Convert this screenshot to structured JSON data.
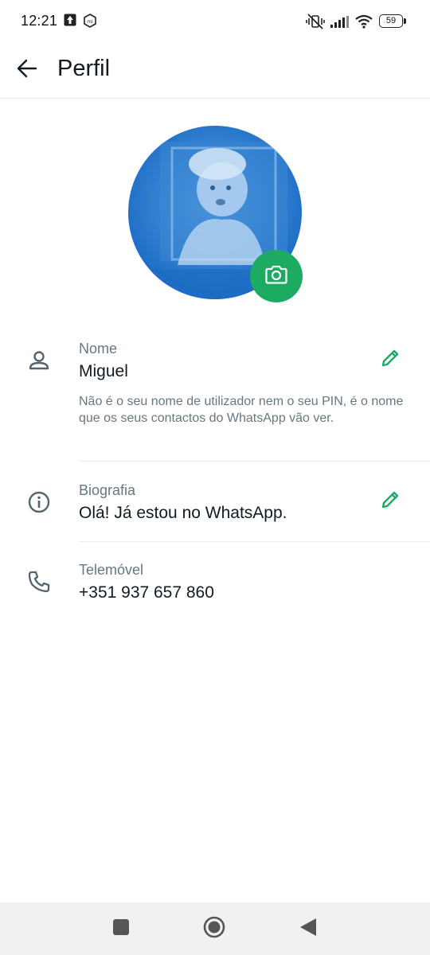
{
  "status_bar": {
    "time": "12:21",
    "battery": "59",
    "icons": [
      "upload-icon",
      "mi-icon",
      "mute-vibrate-icon",
      "signal-icon",
      "wifi-icon",
      "battery-icon"
    ]
  },
  "app_bar": {
    "title": "Perfil",
    "back_icon": "arrow-left-icon"
  },
  "profile": {
    "avatar_icon": "profile-photo",
    "camera_icon": "camera-icon"
  },
  "fields": {
    "name": {
      "label": "Nome",
      "value": "Miguel",
      "hint": "Não é o seu nome de utilizador nem o seu PIN, é o nome que os seus contactos do WhatsApp vão ver.",
      "icon": "person-icon",
      "edit_icon": "pencil-icon"
    },
    "bio": {
      "label": "Biografia",
      "value": "Olá! Já estou no WhatsApp.",
      "icon": "info-icon",
      "edit_icon": "pencil-icon"
    },
    "phone": {
      "label": "Telemóvel",
      "value": "+351 937 657 860",
      "icon": "phone-icon"
    }
  },
  "nav_bar": {
    "icons": [
      "square-recents-icon",
      "circle-home-icon",
      "triangle-back-icon"
    ]
  },
  "colors": {
    "accent": "#1daa61",
    "text_primary": "#111b21",
    "text_secondary": "#667781",
    "avatar_tint": "#1e7bd6"
  }
}
